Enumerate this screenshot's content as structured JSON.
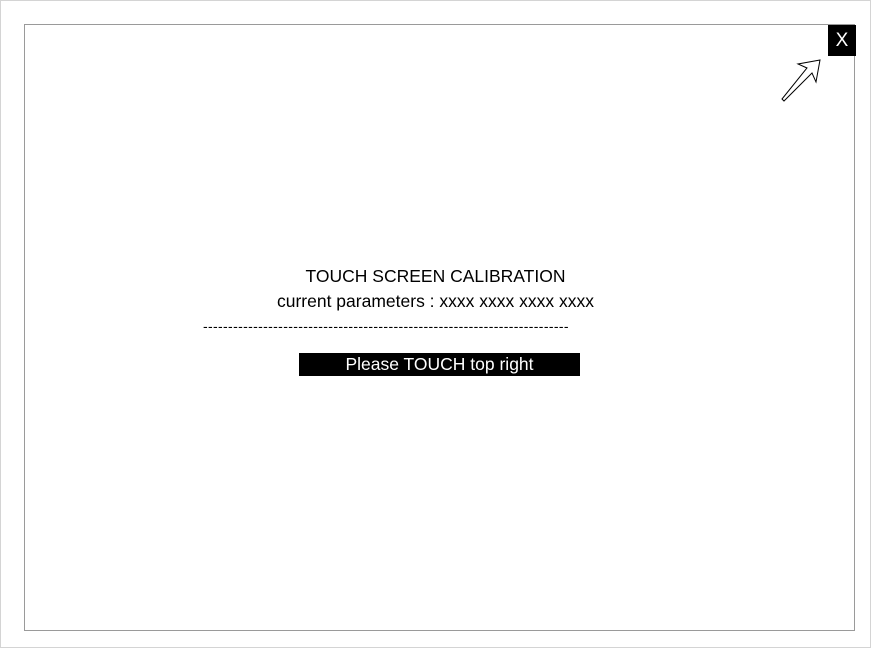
{
  "window": {
    "close_label": "X"
  },
  "calibration": {
    "title": "TOUCH SCREEN CALIBRATION",
    "parameters": "current parameters : xxxx xxxx xxxx xxxx",
    "separator": "-------------------------------------------------------------------------",
    "prompt": "Please TOUCH top right",
    "target_icon": "arrow-up-right-icon"
  },
  "colors": {
    "background": "#ffffff",
    "text": "#000000",
    "highlight_bg": "#000000",
    "highlight_text": "#ffffff",
    "frame": "#9a9a9a"
  }
}
